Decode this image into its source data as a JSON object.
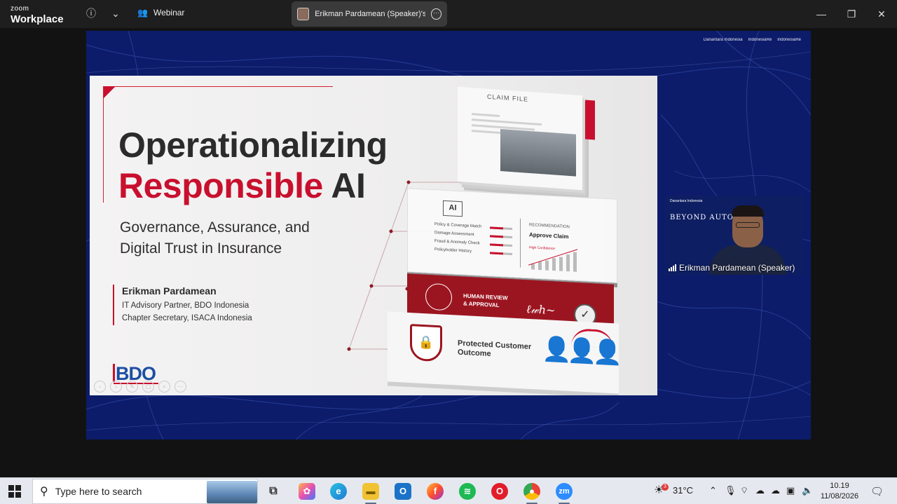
{
  "app": {
    "brand_small": "zoom",
    "brand_name": "Workplace",
    "webinar_label": "Webinar",
    "share_title": "Erikman Pardamean (Speaker)'s sc"
  },
  "stage": {
    "logos": [
      "Danantara Indonesia",
      "IndonesiaRe",
      "IndonesiaRe"
    ]
  },
  "slide": {
    "title_line1": "Operationalizing",
    "title_red": "Responsible",
    "title_dark": " AI",
    "subtitle_line1": "Governance, Assurance, and",
    "subtitle_line2": "Digital Trust in Insurance",
    "speaker_name": "Erikman Pardamean",
    "speaker_role1": "IT Advisory Partner, BDO Indonesia",
    "speaker_role2": "Chapter Secretary, ISACA Indonesia",
    "company_logo": "BDO",
    "graphic": {
      "claim_label": "CLAIM FILE",
      "ai_label": "AI",
      "checks": [
        "Policy & Coverage Match",
        "Damage Assessment",
        "Fraud & Anomaly Check",
        "Policyholder History"
      ],
      "recommendation_label": "RECOMMENDATION",
      "recommendation_value": "Approve Claim",
      "confidence_label": "High Confidence",
      "human_review_line1": "HUMAN REVIEW",
      "human_review_line2": "& APPROVAL",
      "outcome_line1": "Protected Customer",
      "outcome_line2": "Outcome"
    }
  },
  "video": {
    "thumb_brand": "Danantara Indonesia",
    "thumb_title": "BEYOND AUTOM",
    "participant_name": "Erikman Pardamean (Speaker)"
  },
  "taskbar": {
    "search_placeholder": "Type here to search",
    "temperature": "31°C",
    "weather_badge": "3",
    "time": "10.19",
    "date": "11/08/2026"
  },
  "colors": {
    "accent_red": "#c8102e",
    "stage_blue": "#0c1c6a",
    "bdo_blue": "#1d4fa3"
  }
}
